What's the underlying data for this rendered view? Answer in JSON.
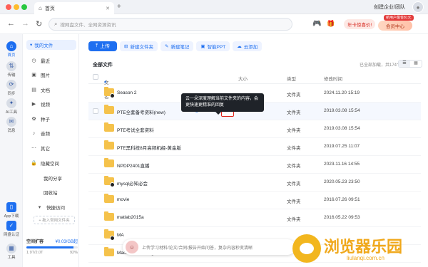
{
  "window": {
    "tab_label": "首页",
    "team_label": "创建企业/团队"
  },
  "navbar": {
    "search_placeholder": "搜网盘文件、全网资源资讯",
    "promo_label": "年卡惊喜价!",
    "member_tag": "新用户最省81元",
    "member_label": "会员中心"
  },
  "rail": {
    "items": [
      {
        "label": "首页",
        "icon": "home-icon"
      },
      {
        "label": "传输",
        "icon": "transfer-icon"
      },
      {
        "label": "同步",
        "icon": "sync-icon"
      },
      {
        "label": "AI工具",
        "icon": "ai-tools-icon"
      },
      {
        "label": "消息",
        "icon": "message-icon"
      },
      {
        "label": "App下载",
        "icon": "app-download-icon"
      },
      {
        "label": "网盘认证",
        "icon": "verify-icon"
      },
      {
        "label": "工具",
        "icon": "tools-icon"
      }
    ]
  },
  "sidebar": {
    "my_files": "我的文件",
    "items": [
      {
        "label": "最近",
        "icon": "clock-icon"
      },
      {
        "label": "图片",
        "icon": "image-icon"
      },
      {
        "label": "文档",
        "icon": "document-icon"
      },
      {
        "label": "视频",
        "icon": "video-icon"
      },
      {
        "label": "种子",
        "icon": "seed-icon"
      },
      {
        "label": "音频",
        "icon": "audio-icon"
      },
      {
        "label": "其它",
        "icon": "more-icon"
      },
      {
        "label": "隐藏空间",
        "icon": "lock-icon"
      }
    ],
    "my_share": "我的分享",
    "recycle": "回收站",
    "quick_access": "快捷访问",
    "add_folder": "+ 拖入常用文件夹",
    "quota_title": "空间扩容",
    "quota_used": "¥0.03/GB起",
    "quota_total": "1.9T/2.0T",
    "quota_percent": "92%",
    "quota_fraction": 0.92
  },
  "toolbar": {
    "upload": "上传",
    "new_folder": "新建文件夹",
    "new_note": "新建笔记",
    "smart_ppt": "智能PPT",
    "cloud_add": "云添加"
  },
  "list": {
    "title": "全部文件",
    "loaded_text": "已全部加载，共174个",
    "view_list": "☰",
    "view_grid": "▦",
    "headers": {
      "name": "文件名",
      "size": "大小",
      "type": "类型",
      "modified": "修改时间"
    },
    "rows": [
      {
        "name": "Season 2",
        "size": "",
        "type": "文件夹",
        "date": "2024.11.20 15:19",
        "badge": true
      },
      {
        "name": "PTE全套备考资料(new)",
        "size": "-",
        "type": "文件夹",
        "date": "2019.03.08 15:54",
        "badge": false
      },
      {
        "name": "PTE考试全套资料",
        "size": "",
        "type": "文件夹",
        "date": "2019.03.08 15:54",
        "badge": false
      },
      {
        "name": "PTE黑科技8月高频机经-黄金版",
        "size": "",
        "type": "文件夹",
        "date": "2019.07.25 11:07",
        "badge": false
      },
      {
        "name": "NPDP2401直播",
        "size": "",
        "type": "文件夹",
        "date": "2023.11.16 14:55",
        "badge": false
      },
      {
        "name": "mysql必知必会",
        "size": "",
        "type": "文件夹",
        "date": "2020.05.23 23:50",
        "badge": true
      },
      {
        "name": "movie",
        "size": "",
        "type": "文件夹",
        "date": "2016.07.26 09:51",
        "badge": false
      },
      {
        "name": "matlab2015a",
        "size": "",
        "type": "文件夹",
        "date": "2016.05.22 09:53",
        "badge": false
      },
      {
        "name": "MA",
        "size": "",
        "type": "",
        "date": "",
        "badge": true
      },
      {
        "name": "Machine Learning",
        "size": "",
        "type": "",
        "date": "",
        "badge": false
      }
    ]
  },
  "tooltip": "云一朵深度理解当前文件夹的内容，会更快速更精准的回复",
  "ai_bar": {
    "text": "上传学习材料/论文/合同/报告开始问答，复杂内容秒变清晰"
  },
  "watermark": {
    "cn": "浏览器乐园",
    "en": "liulanqi.com.cn"
  },
  "colors": {
    "accent": "#1e6ff0",
    "folder": "#f5c24b",
    "highlight_box": "#e0241b"
  }
}
